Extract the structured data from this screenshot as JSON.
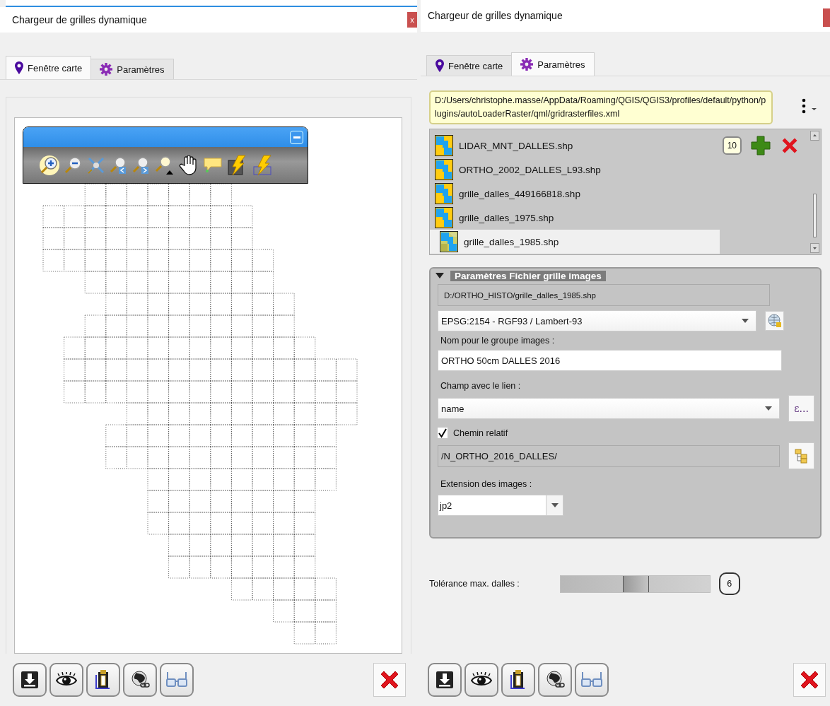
{
  "left_panel": {
    "window": {
      "title": "Chargeur de grilles dynamique",
      "close_label": "x"
    },
    "tabs": [
      {
        "label": "Fenêtre carte",
        "selected": true
      },
      {
        "label": "Paramètres",
        "selected": false
      }
    ]
  },
  "right_panel": {
    "window": {
      "title": "Chargeur de grilles dynamique"
    },
    "tabs": [
      {
        "label": "Fenêtre carte",
        "selected": false
      },
      {
        "label": "Paramètres",
        "selected": true
      }
    ],
    "config_path": "D:/Users/christophe.masse/AppData/Roaming/QGIS/QGIS3/profiles/default/python/plugins/autoLoaderRaster/qml/gridrasterfiles.xml",
    "layer_count": "10",
    "layers": [
      {
        "name": "LIDAR_MNT_DALLES.shp",
        "selected": false
      },
      {
        "name": "ORTHO_2002_DALLES_L93.shp",
        "selected": false
      },
      {
        "name": "grille_dalles_449166818.shp",
        "selected": false
      },
      {
        "name": "grille_dalles_1975.shp",
        "selected": false
      },
      {
        "name": "grille_dalles_1985.shp",
        "selected": true
      }
    ],
    "group": {
      "title": "Paramètres Fichier grille images",
      "expanded": true,
      "file_path": "D:/ORTHO_HISTO/grille_dalles_1985.shp",
      "crs": "EPSG:2154 - RGF93 / Lambert-93",
      "group_name_label": "Nom pour le groupe images :",
      "group_name": "ORTHO 50cm DALLES 2016",
      "link_field_label": "Champ avec le lien :",
      "link_field": "name",
      "expression_label": "ε...",
      "relative_path": {
        "label": "Chemin relatif",
        "checked": true
      },
      "relative_path_value": "/N_ORTHO_2016_DALLES/",
      "extension_label": "Extension des images :",
      "extension": "jp2"
    },
    "tolerance": {
      "label": "Tolérance max. dalles :",
      "level": 0.5,
      "reading": "6"
    }
  }
}
